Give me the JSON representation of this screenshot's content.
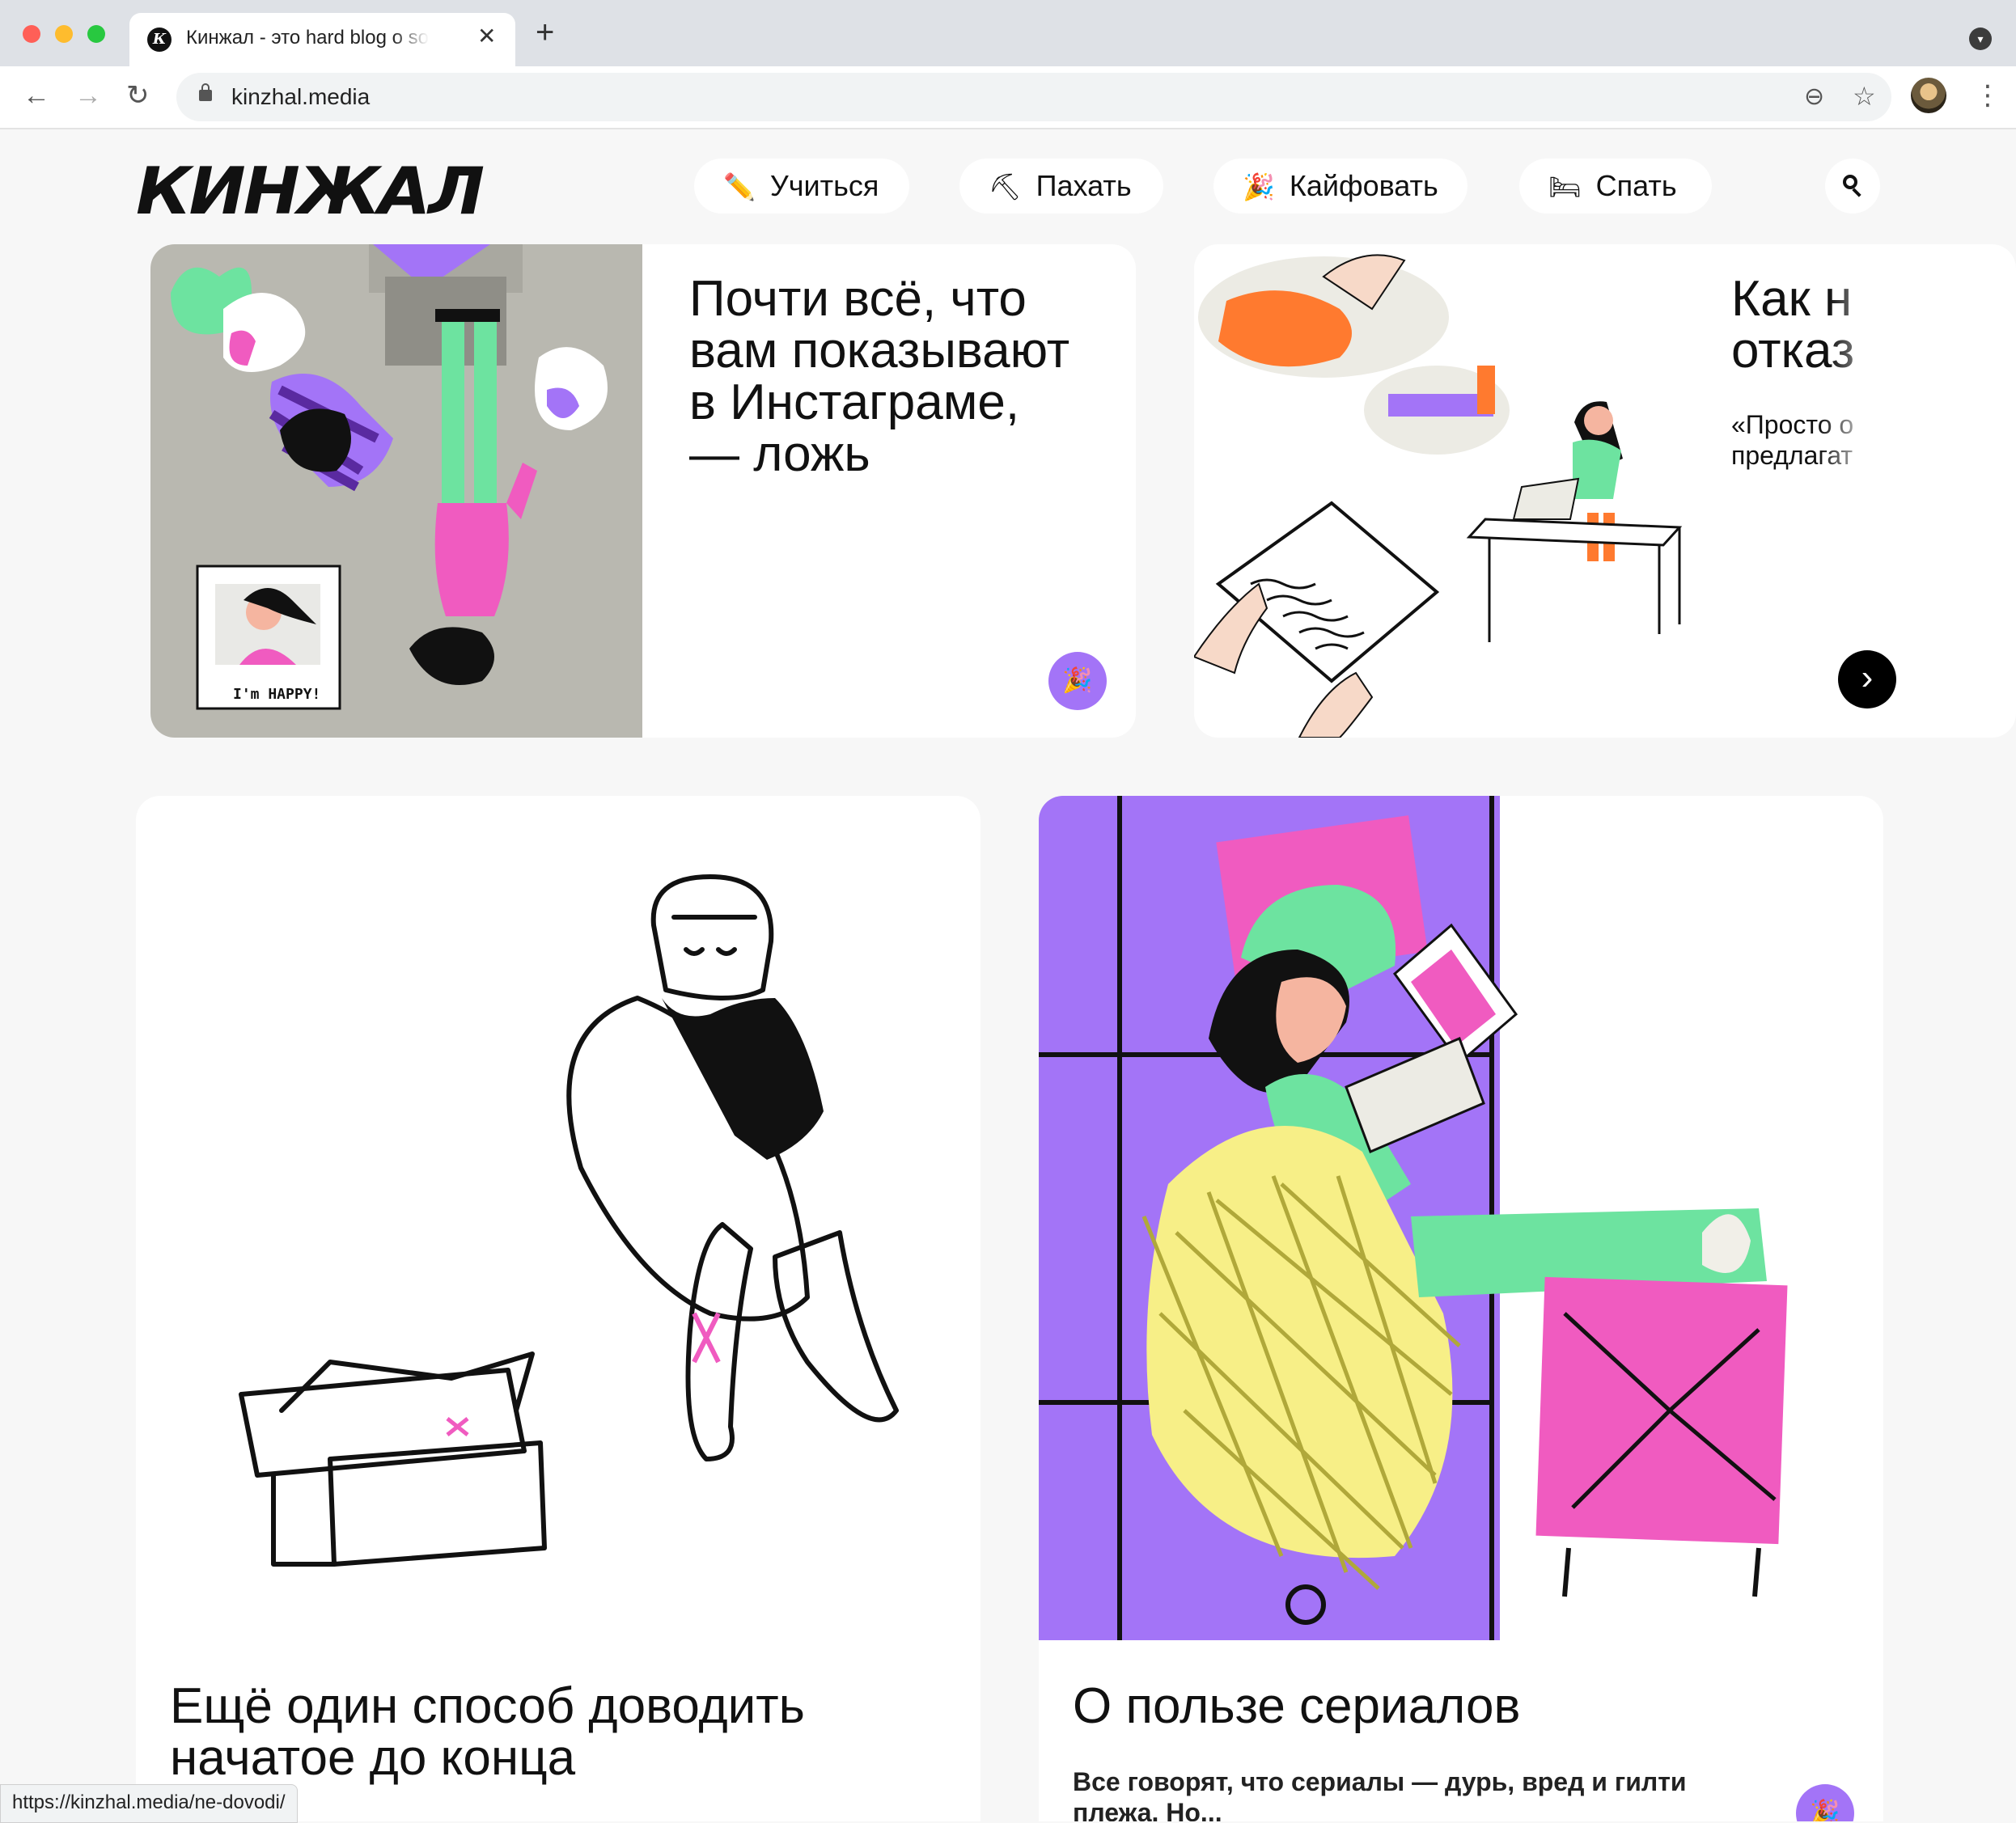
{
  "browser": {
    "tab_title": "Кинжал - это hard blog о soft skills",
    "tab_favicon": "К",
    "close_glyph": "✕",
    "newtab_glyph": "+",
    "url": "kinzhal.media",
    "status_url": "https://kinzhal.media/ne-dovodi/",
    "colors": {
      "close": "#ff5f57",
      "minimize": "#febc2e",
      "maximize": "#28c840"
    }
  },
  "site": {
    "logo": "КИНЖАЛ",
    "nav": [
      {
        "label": "Учиться",
        "icon": "pencil-icon",
        "glyph": "✏️"
      },
      {
        "label": "Пахать",
        "icon": "pickaxe-icon",
        "glyph": "⛏"
      },
      {
        "label": "Кайфовать",
        "icon": "party-popper-icon",
        "glyph": "🎉"
      },
      {
        "label": "Спать",
        "icon": "bed-icon",
        "glyph": "🛏"
      }
    ]
  },
  "carousel": [
    {
      "title": "Почти всё, что\nвам показывают\nв Инстаграме,\n— ложь",
      "badge": "🎉",
      "image_text": "I'm HAPPY!"
    },
    {
      "title": "Как н\nотказ",
      "subtitle": "«Просто о\nпредлагат"
    }
  ],
  "articles": [
    {
      "title": "Ещё один способ доводить\nначатое до конца"
    },
    {
      "title": "О пользе сериалов",
      "excerpt": "Все говорят, что сериалы — дурь, вред и гилти\nплежа. Но...",
      "badge": "🎉"
    }
  ],
  "accent_colors": {
    "purple": "#a374f7",
    "green": "#6de3a0",
    "pink": "#f05bc0",
    "orange": "#ff7a2f"
  }
}
